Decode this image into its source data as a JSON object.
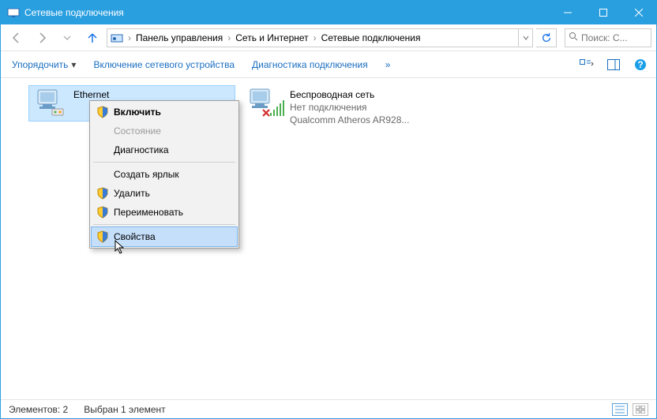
{
  "window": {
    "title": "Сетевые подключения"
  },
  "breadcrumb": {
    "items": [
      "Панель управления",
      "Сеть и Интернет",
      "Сетевые подключения"
    ]
  },
  "search": {
    "placeholder": "Поиск: С..."
  },
  "toolbar": {
    "organize": "Упорядочить",
    "enable_device": "Включение сетевого устройства",
    "diagnose": "Диагностика подключения",
    "more": "»"
  },
  "adapters": {
    "ethernet": {
      "name": "Ethernet"
    },
    "wifi": {
      "name": "Беспроводная сеть",
      "status": "Нет подключения",
      "device": "Qualcomm Atheros AR928..."
    }
  },
  "context_menu": {
    "enable": "Включить",
    "status": "Состояние",
    "diagnose": "Диагностика",
    "create_shortcut": "Создать ярлык",
    "delete": "Удалить",
    "rename": "Переименовать",
    "properties": "Свойства"
  },
  "statusbar": {
    "elements": "Элементов: 2",
    "selected": "Выбран 1 элемент"
  }
}
